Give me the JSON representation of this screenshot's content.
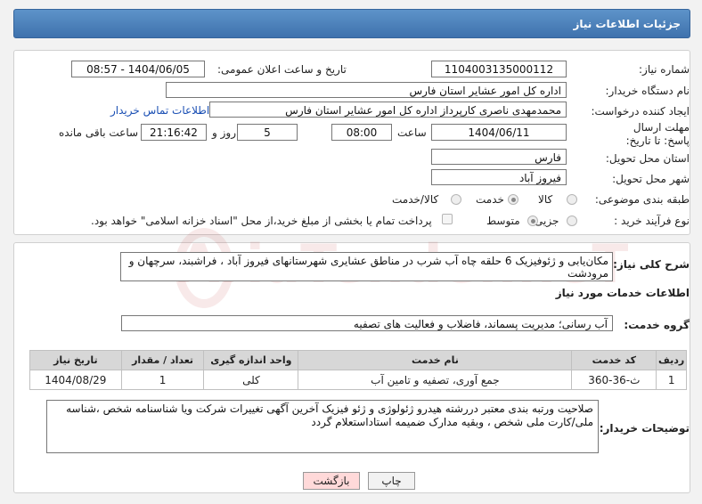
{
  "header": {
    "title": "جزئیات اطلاعات نیاز"
  },
  "form": {
    "need_number_label": "شماره نیاز:",
    "need_number": "1104003135000112",
    "announce_label": "تاریخ و ساعت اعلان عمومی:",
    "announce_value": "1404/06/05 - 08:57",
    "buyer_label": "نام دستگاه خریدار:",
    "buyer_value": "اداره کل امور عشایر استان فارس",
    "creator_label": "ایجاد کننده درخواست:",
    "creator_value": "محمدمهدی ناصری کارپرداز اداره کل امور عشایر استان فارس",
    "contact_link": "اطلاعات تماس خریدار",
    "deadline_label": "مهلت ارسال پاسخ: تا تاریخ:",
    "deadline_date": "1404/06/11",
    "time_label": "ساعت",
    "deadline_time": "08:00",
    "days_value": "5",
    "days_label": "روز و",
    "remaining_time": "21:16:42",
    "remaining_label": "ساعت باقی مانده",
    "province_label": "استان محل تحویل:",
    "province_value": "فارس",
    "city_label": "شهر محل تحویل:",
    "city_value": "فیروز آباد",
    "category_label": "طبقه بندی موضوعی:",
    "category_options": [
      "کالا",
      "خدمت",
      "کالا/خدمت"
    ],
    "category_selected": "خدمت",
    "process_label": "نوع فرآیند خرید :",
    "process_options": [
      "جزیی",
      "متوسط"
    ],
    "process_selected": "متوسط",
    "payment_note": "پرداخت تمام یا بخشی از مبلغ خرید،از محل \"اسناد خزانه اسلامی\" خواهد بود."
  },
  "summary": {
    "label": "شرح کلی نیاز:",
    "text": "مکان‌یابی و ژئوفیزیک 6 حلقه چاه آب شرب در مناطق عشایری شهرستانهای فیروز آباد ، فراشبند، سرچهان و مرودشت"
  },
  "services": {
    "section_title": "اطلاعات خدمات مورد نیاز",
    "group_label": "گروه خدمت:",
    "group_value": "آب رسانی؛ مدیریت پسماند، فاضلاب و فعالیت های تصفیه",
    "columns": [
      "ردیف",
      "کد خدمت",
      "نام خدمت",
      "واحد اندازه گیری",
      "تعداد / مقدار",
      "تاریخ نیاز"
    ],
    "rows": [
      {
        "row": "1",
        "code": "ث-36-360",
        "name": "جمع آوری، تصفیه و تامین آب",
        "unit": "کلی",
        "qty": "1",
        "date": "1404/08/29"
      }
    ]
  },
  "buyer_notes": {
    "label": "توضیحات خریدار:",
    "text": "صلاحیت ورتبه بندی معتبر دررشته هیدرو ژئولوژی و ژئو فیزیک  آخرین آگهی تغییرات شرکت ویا شناسنامه شخص ،شناسه ملی/کارت ملی شخص ، وبقیه مدارک  ضمیمه استاداستعلام گردد"
  },
  "buttons": {
    "print": "چاپ",
    "back": "بازگشت"
  },
  "watermark": {
    "text": "AriaTender.neT"
  },
  "colors": {
    "header": "#4a7fbc",
    "link": "#1a4fb4",
    "back_button": "#ffd9d9"
  }
}
